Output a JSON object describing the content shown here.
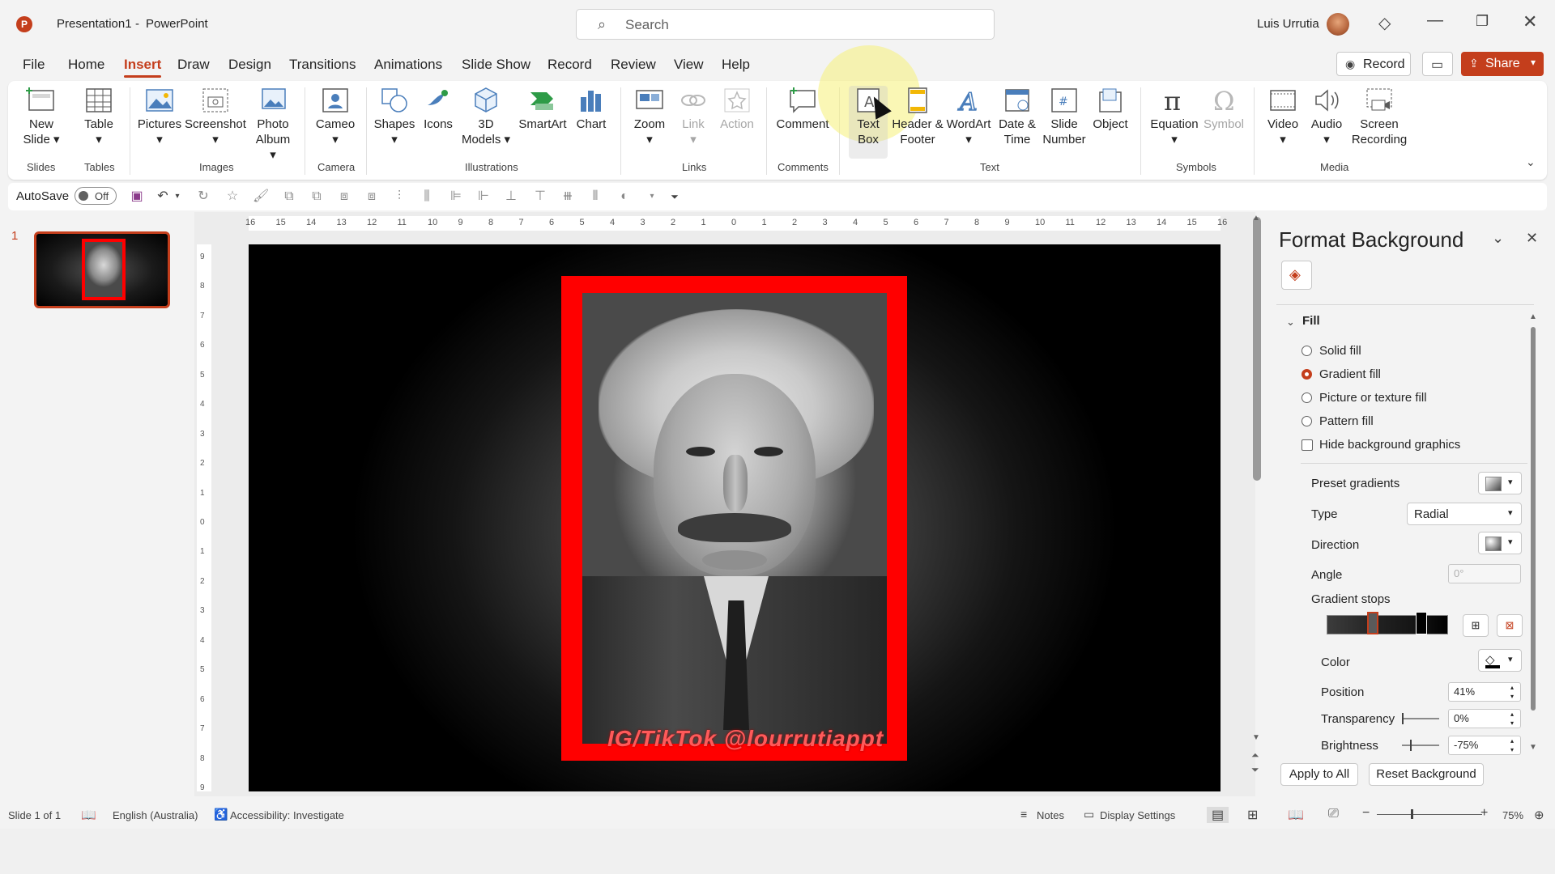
{
  "title_bar": {
    "doc_title": "Presentation1",
    "app_name": "PowerPoint",
    "search_placeholder": "Search",
    "user_name": "Luis Urrutia"
  },
  "menu": {
    "tabs": [
      "File",
      "Home",
      "Insert",
      "Draw",
      "Design",
      "Transitions",
      "Animations",
      "Slide Show",
      "Record",
      "Review",
      "View",
      "Help"
    ],
    "active_tab": "Insert",
    "record_label": "Record",
    "share_label": "Share"
  },
  "ribbon": {
    "new_slide": "New Slide",
    "table": "Table",
    "pictures": "Pictures",
    "screenshot": "Screenshot",
    "photo_album": "Photo Album",
    "cameo": "Cameo",
    "shapes": "Shapes",
    "icons": "Icons",
    "models_3d": "3D Models",
    "smartart": "SmartArt",
    "chart": "Chart",
    "zoom": "Zoom",
    "link": "Link",
    "action": "Action",
    "comment": "Comment",
    "text_box": "Text Box",
    "header_footer": "Header & Footer",
    "wordart": "WordArt",
    "date_time": "Date & Time",
    "slide_number": "Slide Number",
    "object": "Object",
    "equation": "Equation",
    "symbol": "Symbol",
    "video": "Video",
    "audio": "Audio",
    "screen_recording": "Screen Recording",
    "groups": {
      "slides": "Slides",
      "tables": "Tables",
      "images": "Images",
      "camera": "Camera",
      "illustrations": "Illustrations",
      "links": "Links",
      "comments": "Comments",
      "text": "Text",
      "symbols": "Symbols",
      "media": "Media"
    }
  },
  "qat": {
    "autosave_label": "AutoSave",
    "autosave_state": "Off"
  },
  "thumbnails": {
    "slide_number": "1"
  },
  "ruler": {
    "h_ticks": [
      "16",
      "15",
      "14",
      "13",
      "12",
      "11",
      "10",
      "9",
      "8",
      "7",
      "6",
      "5",
      "4",
      "3",
      "2",
      "1",
      "0",
      "1",
      "2",
      "3",
      "4",
      "5",
      "6",
      "7",
      "8",
      "9",
      "10",
      "11",
      "12",
      "13",
      "14",
      "15",
      "16"
    ],
    "v_ticks": [
      "9",
      "8",
      "7",
      "6",
      "5",
      "4",
      "3",
      "2",
      "1",
      "0",
      "1",
      "2",
      "3",
      "4",
      "5",
      "6",
      "7",
      "8",
      "9"
    ]
  },
  "slide": {
    "watermark": "IG/TikTok @lourrutiappt"
  },
  "format_panel": {
    "title": "Format Background",
    "fill_header": "Fill",
    "solid_fill": "Solid fill",
    "gradient_fill": "Gradient fill",
    "picture_fill": "Picture or texture fill",
    "pattern_fill": "Pattern fill",
    "hide_graphics": "Hide background graphics",
    "preset_gradients": "Preset gradients",
    "type_label": "Type",
    "type_value": "Radial",
    "direction_label": "Direction",
    "angle_label": "Angle",
    "angle_value": "0°",
    "gradient_stops": "Gradient stops",
    "color_label": "Color",
    "position_label": "Position",
    "position_value": "41%",
    "transparency_label": "Transparency",
    "transparency_value": "0%",
    "brightness_label": "Brightness",
    "brightness_value": "-75%",
    "apply_all": "Apply to All",
    "reset_background": "Reset Background"
  },
  "status_bar": {
    "slide_info": "Slide 1 of 1",
    "language": "English (Australia)",
    "accessibility": "Accessibility: Investigate",
    "notes": "Notes",
    "display_settings": "Display Settings",
    "zoom": "75%"
  },
  "colors": {
    "accent": "#c43e1c",
    "frame_red": "#ff0000"
  }
}
